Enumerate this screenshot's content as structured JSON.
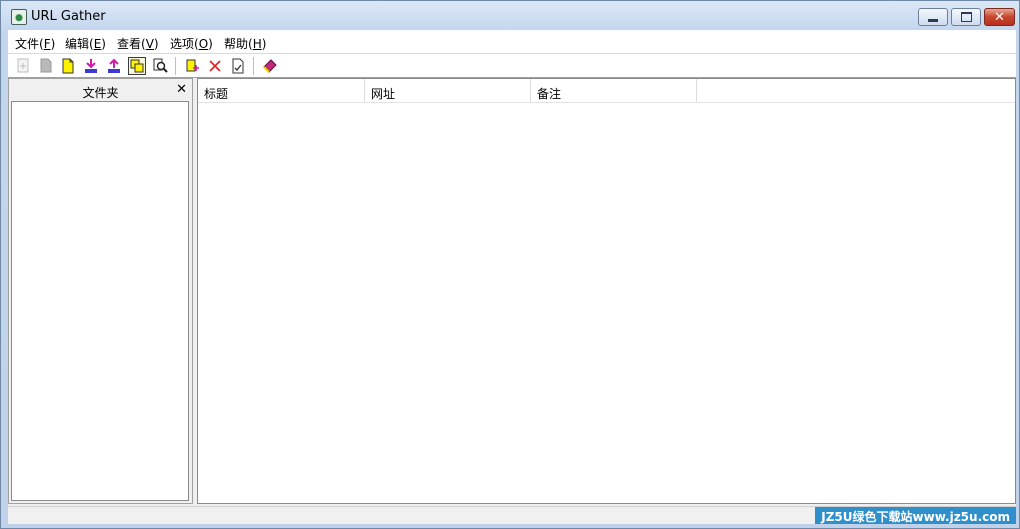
{
  "window": {
    "title": "URL Gather",
    "icon": "url-gather-app-icon",
    "controls": {
      "minimize_icon": "minimize-icon",
      "maximize_icon": "maximize-icon",
      "close_icon": "close-icon"
    }
  },
  "menubar": {
    "items": [
      {
        "label": "文件(",
        "key": "F",
        "end": ")"
      },
      {
        "label": "编辑(",
        "key": "E",
        "end": ")"
      },
      {
        "label": "查看(",
        "key": "V",
        "end": ")"
      },
      {
        "label": "选项(",
        "key": "O",
        "end": ")"
      },
      {
        "label": "帮助(",
        "key": "H",
        "end": ")"
      }
    ]
  },
  "toolbar": {
    "buttons": [
      {
        "icon": "new-folder-icon",
        "state": "disabled"
      },
      {
        "icon": "page-icon",
        "state": "disabled"
      },
      {
        "icon": "new-page-icon",
        "state": "enabled"
      },
      {
        "icon": "import-icon",
        "state": "enabled"
      },
      {
        "icon": "export-icon",
        "state": "enabled"
      },
      {
        "icon": "folders-toggle-icon",
        "state": "pressed"
      },
      {
        "icon": "search-icon",
        "state": "enabled"
      },
      {
        "icon": "add-url-icon",
        "state": "enabled"
      },
      {
        "icon": "delete-icon",
        "state": "enabled"
      },
      {
        "icon": "edit-icon",
        "state": "enabled"
      },
      {
        "icon": "help-book-icon",
        "state": "enabled"
      }
    ]
  },
  "folder_pane": {
    "title": "文件夹",
    "close_glyph": "✕"
  },
  "list_view": {
    "columns": [
      {
        "label": "标题"
      },
      {
        "label": "网址"
      },
      {
        "label": "备注"
      }
    ],
    "rows": []
  },
  "statusbar": {
    "watermark": "JZ5U绿色下载站www.jz5u.com"
  },
  "colors": {
    "title_bar": "#c3d6ee",
    "close_button": "#c6452e",
    "watermark_bg": "#2f8fcb"
  }
}
